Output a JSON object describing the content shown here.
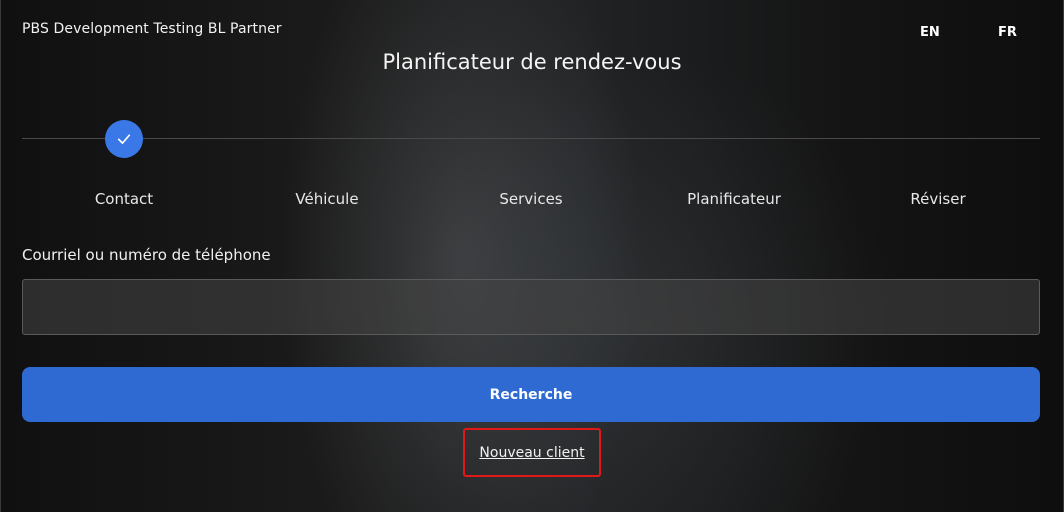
{
  "header": {
    "brand": "PBS Development Testing BL Partner",
    "title": "Planificateur de rendez-vous",
    "languages": [
      {
        "label": "EN"
      },
      {
        "label": "FR"
      }
    ]
  },
  "stepper": {
    "completed_icon": "check-icon",
    "steps": [
      {
        "label": "Contact",
        "status": "active"
      },
      {
        "label": "Véhicule"
      },
      {
        "label": "Services"
      },
      {
        "label": "Planificateur"
      },
      {
        "label": "Réviser"
      }
    ]
  },
  "form": {
    "field_label": "Courriel ou numéro de téléphone",
    "field_value": "",
    "field_placeholder": "",
    "search_label": "Recherche",
    "new_client_label": "Nouveau client"
  },
  "colors": {
    "accent": "#2f6ad3",
    "step_active": "#3b78e7",
    "highlight": "#e01818"
  }
}
